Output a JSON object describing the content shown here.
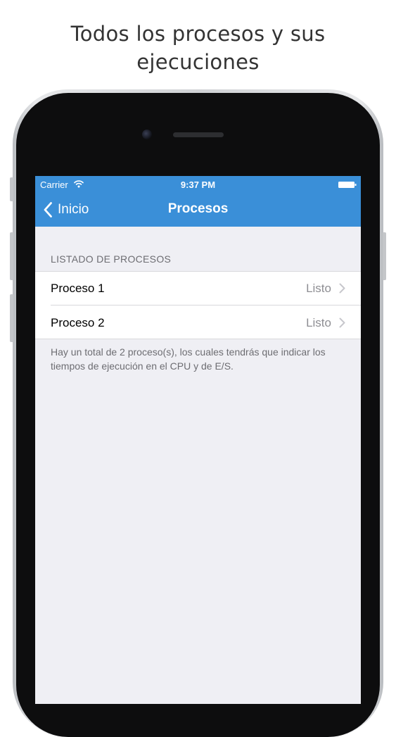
{
  "caption": {
    "line1": "Todos los procesos y sus",
    "line2": "ejecuciones"
  },
  "status_bar": {
    "carrier": "Carrier",
    "time": "9:37 PM"
  },
  "nav": {
    "back_label": "Inicio",
    "title": "Procesos"
  },
  "section": {
    "header": "LISTADO DE PROCESOS",
    "rows": [
      {
        "title": "Proceso 1",
        "detail": "Listo"
      },
      {
        "title": "Proceso 2",
        "detail": "Listo"
      }
    ],
    "footer": "Hay un total de 2 proceso(s), los cuales tendrás que indicar los tiempos de ejecución en el CPU y de E/S."
  },
  "colors": {
    "nav_bar": "#3a8fd8",
    "background": "#efeff4",
    "secondary_text": "#8e8e93"
  },
  "icons": [
    "wifi-icon",
    "battery-icon",
    "back-chevron-icon",
    "disclosure-chevron-icon"
  ]
}
